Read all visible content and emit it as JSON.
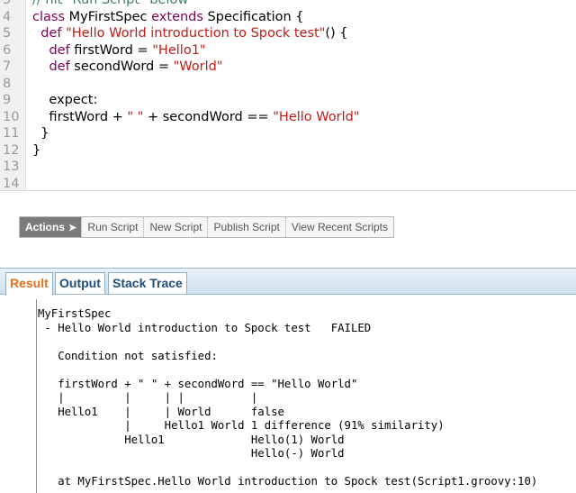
{
  "editor": {
    "lines": [
      {
        "num": "3",
        "text": "// hit \"Run Script\" below"
      },
      {
        "num": "4",
        "text": "class MyFirstSpec extends Specification {"
      },
      {
        "num": "5",
        "text": "  def \"Hello World introduction to Spock test\"() {"
      },
      {
        "num": "6",
        "text": "    def firstWord = \"Hello1\""
      },
      {
        "num": "7",
        "text": "    def secondWord = \"World\""
      },
      {
        "num": "8",
        "text": ""
      },
      {
        "num": "9",
        "text": "    expect:"
      },
      {
        "num": "10",
        "text": "    firstWord + \" \" + secondWord == \"Hello World\""
      },
      {
        "num": "11",
        "text": "  }"
      },
      {
        "num": "12",
        "text": "}"
      },
      {
        "num": "13",
        "text": ""
      },
      {
        "num": "14",
        "text": ""
      }
    ],
    "colors": {
      "keyword": "#7f0055",
      "string": "#c41a16",
      "comment": "#3f7f5f"
    }
  },
  "toolbar": {
    "actions_label": "Actions",
    "buttons": [
      "Run Script",
      "New Script",
      "Publish Script",
      "View Recent Scripts"
    ]
  },
  "tabs": [
    {
      "label": "Result",
      "active": true
    },
    {
      "label": "Output",
      "active": false
    },
    {
      "label": "Stack Trace",
      "active": false
    }
  ],
  "result": {
    "lines": [
      "MyFirstSpec",
      " - Hello World introduction to Spock test   FAILED",
      "",
      "   Condition not satisfied:",
      "",
      "   firstWord + \" \" + secondWord == \"Hello World\"",
      "   |         |     | |          |",
      "   Hello1    |     | World      false",
      "             |     Hello1 World 1 difference (91% similarity)",
      "             Hello1             Hello(1) World",
      "                                Hello(-) World",
      "",
      "   at MyFirstSpec.Hello World introduction to Spock test(Script1.groovy:10)"
    ]
  }
}
